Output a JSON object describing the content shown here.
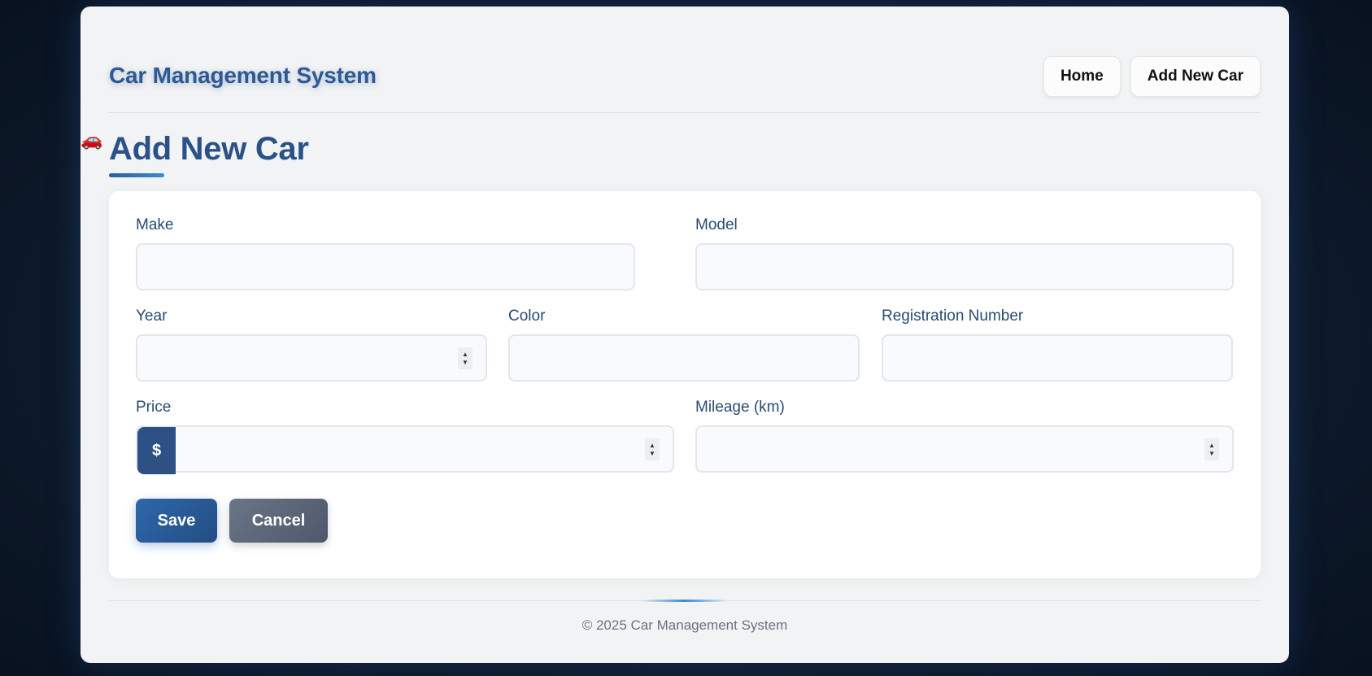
{
  "header": {
    "brand": "Car Management System",
    "nav": [
      "Home",
      "Add New Car"
    ]
  },
  "page": {
    "title_icon": "🚗",
    "title": "Add New Car"
  },
  "form": {
    "make_label": "Make",
    "model_label": "Model",
    "year_label": "Year",
    "color_label": "Color",
    "registration_label": "Registration Number",
    "price_label": "Price",
    "price_prefix": "$",
    "mileage_label": "Mileage (km)",
    "save_label": "Save",
    "cancel_label": "Cancel"
  },
  "footer": {
    "text": "© 2025 Car Management System"
  },
  "colors": {
    "primary": "#2d5a94",
    "accent": "#3a8ad8",
    "cancel": "#5d6779"
  }
}
